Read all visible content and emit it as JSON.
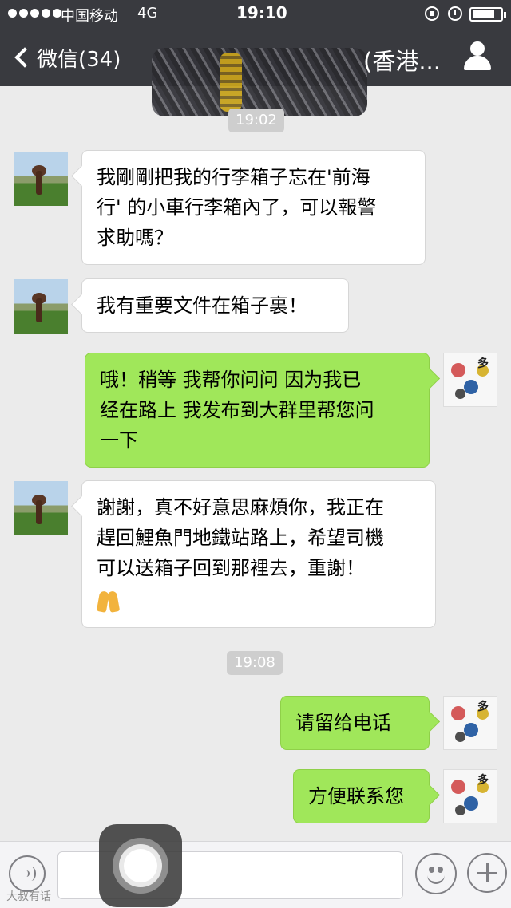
{
  "status_bar": {
    "carrier": "中国移动",
    "network": "4G",
    "time": "19:10",
    "icons": [
      "signal-icon",
      "rotation-lock-icon",
      "alarm-icon",
      "battery-icon"
    ],
    "battery_level": 0.8
  },
  "nav": {
    "back_label": "微信(34)",
    "title_visible": "(香港...",
    "icons": [
      "back-chevron-icon",
      "profile-icon"
    ]
  },
  "chat": {
    "timestamps": [
      "19:02",
      "19:08"
    ],
    "messages": [
      {
        "side": "incoming",
        "text": "我剛剛把我的行李箱子忘在'前海行' 的小車行李箱內了，可以報警求助嗎？",
        "lines": [
          "我剛剛把我的行李箱子忘在'前海",
          "行' 的小車行李箱內了，可以報警",
          "求助嗎？"
        ]
      },
      {
        "side": "incoming",
        "text": "我有重要文件在箱子裏！",
        "lines": [
          "我有重要文件在箱子裏！"
        ]
      },
      {
        "side": "outgoing",
        "text": "哦！稍等  我帮你问问  因为我已经在路上  我发布到大群里帮您问一下",
        "lines": [
          "哦！稍等  我帮你问问  因为我已",
          "经在路上  我发布到大群里帮您问",
          "一下"
        ]
      },
      {
        "side": "incoming",
        "text": "謝謝，真不好意思麻煩你，我正在趕回鯉魚門地鐵站路上，希望司機可以送箱子回到那裡去，重謝！",
        "lines": [
          "謝謝，真不好意思麻煩你，我正在",
          "趕回鯉魚門地鐵站路上，希望司機",
          "可以送箱子回到那裡去，重謝！"
        ],
        "emoji": "folded-hands-emoji"
      },
      {
        "side": "outgoing",
        "text": "请留给电话",
        "lines": [
          "请留给电话"
        ]
      },
      {
        "side": "outgoing",
        "text": "方便联系您",
        "lines": [
          "方便联系您"
        ]
      }
    ]
  },
  "input_bar": {
    "icons": [
      "voice-icon",
      "emoji-icon",
      "plus-icon"
    ]
  },
  "overlay": {
    "assistive_touch": "assistive-touch-button",
    "watermark": "大叔有话"
  },
  "colors": {
    "nav_bg": "#393a3f",
    "chat_bg": "#ebebeb",
    "outgoing_bubble": "#a0e75a",
    "incoming_bubble": "#ffffff",
    "timestamp_bg": "#cecece"
  }
}
